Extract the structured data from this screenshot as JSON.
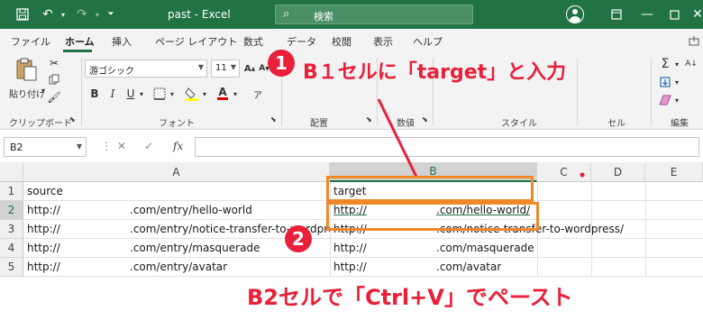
{
  "window": {
    "title": "past  -  Excel",
    "search_label": "検索"
  },
  "ribbon_tabs": [
    "ファイル",
    "ホーム",
    "挿入",
    "ページ レイアウト",
    "数式",
    "データ",
    "校閲",
    "表示",
    "ヘルプ"
  ],
  "ribbon": {
    "paste_label": "貼り付け",
    "font_name": "游ゴシック",
    "font_size": "11",
    "bold": "B",
    "italic": "I",
    "underline": "U",
    "groups": {
      "clipboard": "クリップボード",
      "font": "フォント",
      "alignment": "配置",
      "number": "数値",
      "styles": "スタイル",
      "cells": "セル",
      "editing": "編集"
    }
  },
  "formula_bar": {
    "name_box": "B2",
    "fx_label": "fx",
    "formula": ""
  },
  "grid": {
    "columns": [
      "A",
      "B",
      "C",
      "D",
      "E"
    ],
    "rows": [
      "1",
      "2",
      "3",
      "4",
      "5"
    ],
    "selected_cell": "B2",
    "cells": {
      "A1": "source",
      "A2_prefix": "http://",
      "A2_suffix": ".com/entry/hello-world",
      "A3_prefix": "http://",
      "A3_suffix": ".com/entry/notice-transfer-to-wordpress/",
      "A4_prefix": "http://",
      "A4_suffix": ".com/entry/masquerade",
      "A5_prefix": "http://",
      "A5_suffix": ".com/entry/avatar",
      "B1": "target",
      "B2_prefix": "http://",
      "B2_suffix": ".com/hello-world/",
      "B3_prefix": "http://",
      "B3_suffix": ".com/notice-transfer-to-wordpress/",
      "B4_prefix": "http://",
      "B4_suffix": ".com/masquerade",
      "B5_prefix": "http://",
      "B5_suffix": ".com/avatar"
    }
  },
  "annotations": {
    "step1_badge": "1",
    "step1_text": "B１セルに「target」と入力",
    "step2_badge": "2",
    "step2_text": "B2セルで「Ctrl+V」でペースト"
  },
  "colors": {
    "excel_green": "#217346",
    "annotation_red": "#e8203a",
    "highlight_orange": "#f0882a"
  }
}
